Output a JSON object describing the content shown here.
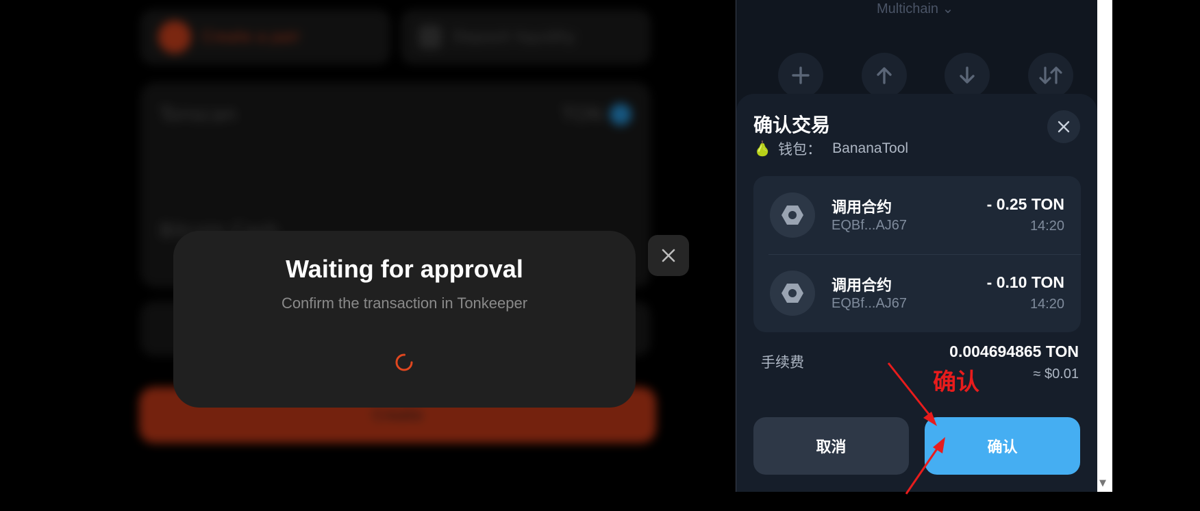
{
  "background_app": {
    "tab_create_label": "Create a pair",
    "tab_deposit_label": "Deposit liquidity",
    "card_token_label": "Tonscan",
    "card_token_value": "TON",
    "card_balance": "Unlimited TON",
    "card_bottom_label": "Bitcoin Cash",
    "card_bottom_value": "BCH",
    "create_label": "Create"
  },
  "waiting_modal": {
    "title": "Waiting for approval",
    "subtitle": "Confirm the transaction in Tonkeeper",
    "spinner_color": "#e0471f"
  },
  "wallet": {
    "network_label": "Multichain",
    "actions": [
      "plus-icon",
      "arrow-up-icon",
      "arrow-down-icon",
      "swap-icon"
    ],
    "sheet": {
      "title": "确认交易",
      "wallet_label": "钱包：",
      "wallet_name": "BananaTool",
      "wallet_emoji": "🍐",
      "transactions": [
        {
          "title": "调用合约",
          "address": "EQBf...AJ67",
          "amount": "- 0.25 TON",
          "time": "14:20"
        },
        {
          "title": "调用合约",
          "address": "EQBf...AJ67",
          "amount": "- 0.10 TON",
          "time": "14:20"
        }
      ],
      "fee_label": "手续费",
      "fee_amount": "0.004694865 TON",
      "fee_usd": "≈ $0.01",
      "cancel_label": "取消",
      "confirm_label": "确认"
    }
  },
  "annotation": {
    "text": "确认",
    "color": "#e81c1c"
  }
}
